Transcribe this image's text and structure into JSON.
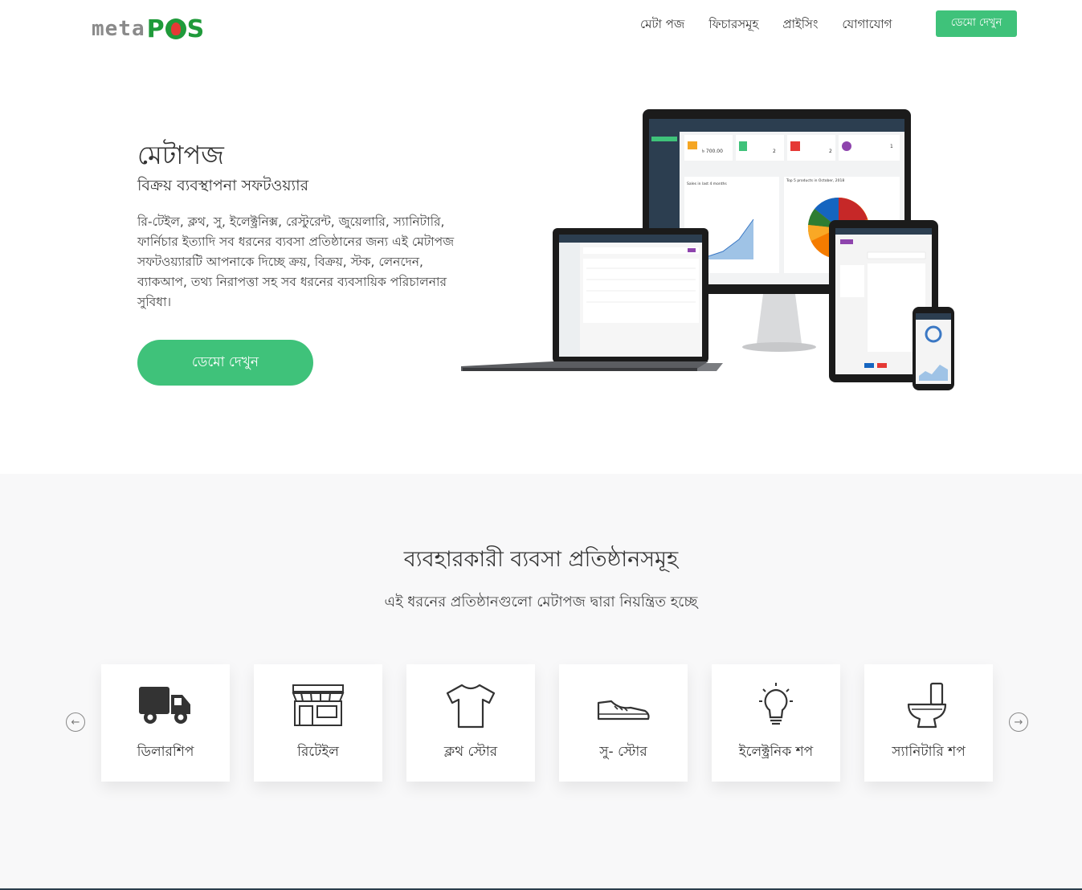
{
  "nav": {
    "logo_meta": "meta",
    "logo_pos": "POS",
    "links": [
      "মেটা পজ",
      "ফিচারসমূহ",
      "প্রাইসিং",
      "যোগাযোগ"
    ],
    "demo_button": "ডেমো দেখুন"
  },
  "hero": {
    "title": "মেটাপজ",
    "subtitle": "বিক্রয় ব্যবস্থাপনা সফটওয়্যার",
    "description": "রি-টেইল, ক্লথ, সু, ইলেক্ট্রনিক্স, রেস্টুরেন্ট, জুয়েলারি, স্যানিটারি, ফার্নিচার ইত্যাদি সব ধরনের ব্যবসা প্রতিষ্ঠানের জন্য এই মেটাপজ সফটওয়্যারটি আপনাকে দিচ্ছে ক্রয়, বিক্রয়, স্টক, লেনদেন, ব্যাকআপ, তথ্য নিরাপত্তা সহ সব ধরনের ব্যবসায়িক পরিচালনার সুবিধা।",
    "demo_button": "ডেমো দেখুন"
  },
  "screen": {
    "sale_amount": "৳ 700.00",
    "new_services": "2",
    "item_sold": "2",
    "new_customers": "1",
    "chart1_title": "Sales in last 4 months",
    "chart2_title": "Top 5 products in October, 2018"
  },
  "business": {
    "title": "ব্যবহারকারী ব্যবসা প্রতিষ্ঠানসমূহ",
    "subtitle": "এই ধরনের প্রতিষ্ঠানগুলো মেটাপজ দ্বারা নিয়ন্ত্রিত হচ্ছে",
    "cards": [
      {
        "label": "ডিলারশিপ",
        "icon": "truck-icon"
      },
      {
        "label": "রিটেইল",
        "icon": "storefront-icon"
      },
      {
        "label": "ক্লথ স্টোর",
        "icon": "tshirt-icon"
      },
      {
        "label": "সু- স্টোর",
        "icon": "shoe-icon"
      },
      {
        "label": "ইলেক্ট্রনিক শপ",
        "icon": "lightbulb-icon"
      },
      {
        "label": "স্যানিটারি শপ",
        "icon": "toilet-icon"
      }
    ],
    "prev_icon": "arrow-left-circle-icon",
    "next_icon": "arrow-right-circle-icon"
  },
  "colors": {
    "accent_green": "#3fc27a",
    "logo_green": "#1f9a3a",
    "logo_gray": "#8a8a8a",
    "section_bg": "#f8f8f9"
  }
}
